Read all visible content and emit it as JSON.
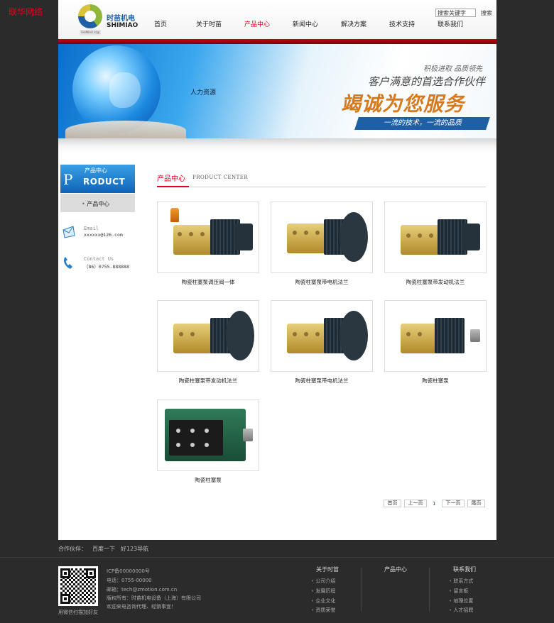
{
  "corner_tag": "联华网络",
  "logo": {
    "cn": "时苗机电",
    "en": "SHIMIAO",
    "sub": "SHIMIAO 时苗"
  },
  "nav": [
    "首页",
    "关于时苗",
    "产品中心",
    "新闻中心",
    "解决方案",
    "技术支持",
    "联系我们"
  ],
  "nav_active": "产品中心",
  "search": {
    "value": "搜索关键字",
    "button": "搜索"
  },
  "banner": {
    "hr_text": "人力资源",
    "slogan": "积极进取 品质领先",
    "sub": "客户满意的首选合作伙伴",
    "main": "竭诚为您服务",
    "tag": "一流的技术，一流的品质"
  },
  "sidebar": {
    "head_cn": "产品中心",
    "head_letter": "P",
    "head_en": "RODUCT",
    "item": "产品中心",
    "email_label": "Email",
    "email_value": "xxxxxx@126.com",
    "contact_label": "Contact Us",
    "contact_value": "（86）0755-888888"
  },
  "section": {
    "title": "产品中心",
    "en": "PRODUCT CENTER"
  },
  "products": [
    "陶瓷柱塞泵调压阀一体",
    "陶瓷柱塞泵带电机法兰",
    "陶瓷柱塞泵带发动机法兰",
    "陶瓷柱塞泵带发动机法兰",
    "陶瓷柱塞泵带电机法兰",
    "陶瓷柱塞泵",
    "陶瓷柱塞泵"
  ],
  "pager": {
    "first": "首页",
    "prev": "上一页",
    "current": "1",
    "next": "下一页",
    "last": "尾页"
  },
  "partners": {
    "label": "合作伙伴：",
    "links": [
      "百度一下",
      "好123导航"
    ]
  },
  "footer": {
    "qr_caption": "用微信扫描加好友",
    "icp": "ICP备00000000号",
    "phone": "电话：0755-00000",
    "email": "邮箱：tech@zmotion.com.cn",
    "copyright": "版权所有：时苗机电设备（上海）有限公司",
    "welcome": "欢迎来电咨询代理、经销事宜！",
    "col1_title": "关于时苗",
    "col1_links": [
      "公司介绍",
      "发展历程",
      "企业文化",
      "资质荣誉"
    ],
    "col2_title": "产品中心",
    "col3_title": "联系我们",
    "col3_links": [
      "联系方式",
      "留言板",
      "地理位置",
      "人才招聘"
    ]
  },
  "colors": {
    "accent_red": "#e5001c",
    "brand_blue": "#1f5fa6",
    "footer_bg": "#2b2b2b"
  }
}
